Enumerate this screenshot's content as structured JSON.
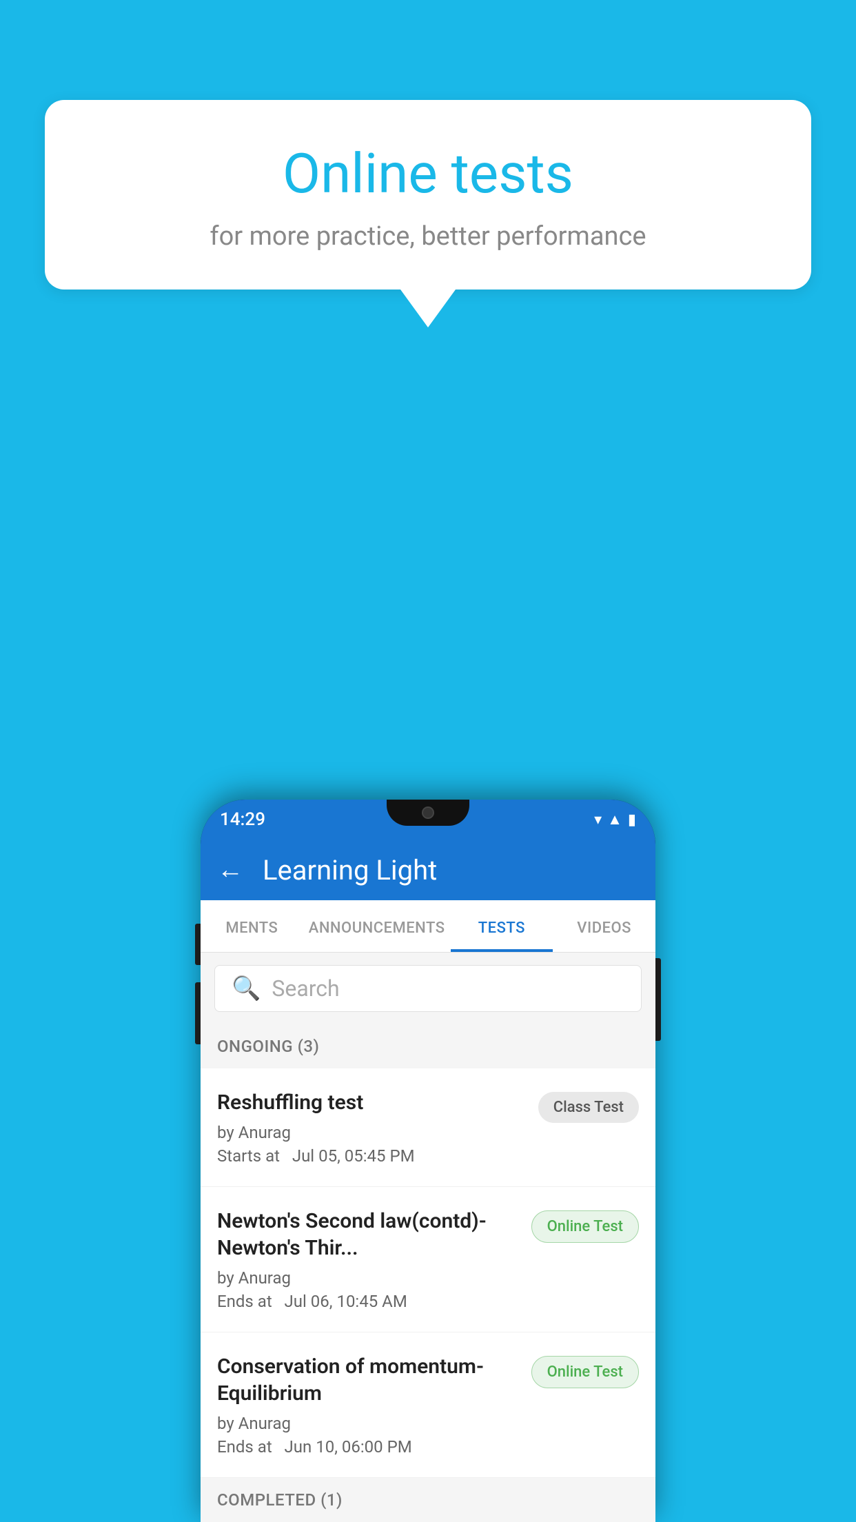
{
  "background_color": "#1ab8e8",
  "speech_bubble": {
    "title": "Online tests",
    "subtitle": "for more practice, better performance"
  },
  "phone": {
    "status_bar": {
      "time": "14:29",
      "icons": [
        "wifi",
        "signal",
        "battery"
      ]
    },
    "app_header": {
      "back_label": "←",
      "title": "Learning Light"
    },
    "tabs": [
      {
        "label": "MENTS",
        "active": false
      },
      {
        "label": "ANNOUNCEMENTS",
        "active": false
      },
      {
        "label": "TESTS",
        "active": true
      },
      {
        "label": "VIDEOS",
        "active": false
      }
    ],
    "search": {
      "placeholder": "Search"
    },
    "ongoing_section": {
      "label": "ONGOING (3)"
    },
    "tests": [
      {
        "title": "Reshuffling test",
        "author": "by Anurag",
        "time_label": "Starts at",
        "time": "Jul 05, 05:45 PM",
        "badge": "Class Test",
        "badge_type": "class"
      },
      {
        "title": "Newton's Second law(contd)-Newton's Thir...",
        "author": "by Anurag",
        "time_label": "Ends at",
        "time": "Jul 06, 10:45 AM",
        "badge": "Online Test",
        "badge_type": "online"
      },
      {
        "title": "Conservation of momentum-Equilibrium",
        "author": "by Anurag",
        "time_label": "Ends at",
        "time": "Jun 10, 06:00 PM",
        "badge": "Online Test",
        "badge_type": "online"
      }
    ],
    "completed_section": {
      "label": "COMPLETED (1)"
    }
  }
}
